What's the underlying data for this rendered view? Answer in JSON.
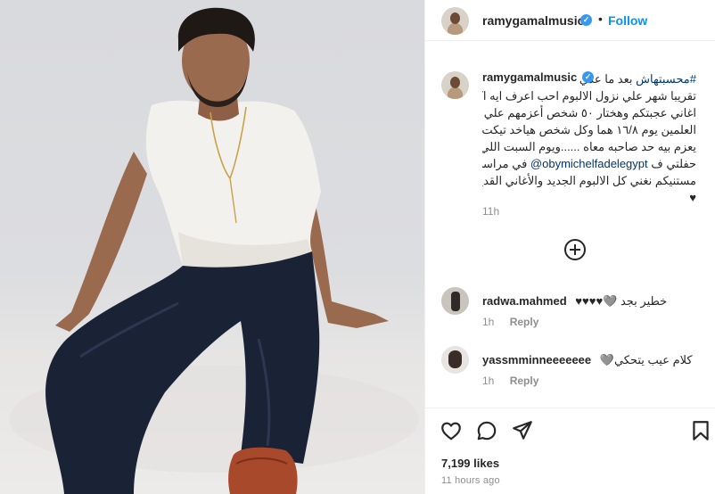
{
  "post": {
    "author": "ramygamalmusic",
    "dot": "•",
    "follow_label": "Follow",
    "verified_glyph": "✓"
  },
  "caption": {
    "username": "ramygamalmusic",
    "hashtag": "#محسبتهاش",
    "line1_rest": " بعد ما عدي",
    "line2": "تقريبا شهر علي نزول الالبوم احب اعرف ايه اكتر",
    "line3": "اغاني عجبتكم وهختار ٥٠ شخص أعزمهم علي حفله",
    "line4": "العلمين يوم ١٦/٨ هما وكل شخص هياخد تيكت زياده",
    "line5": "يعزم بيه حد صاحبه معاه ......ويوم السبت اللي جي ٨/٣",
    "line6_start": "حفلتي ف ",
    "mention": "@obymichelfadelegypt",
    "line6_end": " في مراسي",
    "line7": "مستنيكم نغني كل الالبوم الجديد والأغاني القديمه سوا ♥",
    "line8": "♥",
    "time": "11h"
  },
  "comments": [
    {
      "username": "radwa.mahmed",
      "text": "خطير بجد 🩶♥♥♥♥",
      "time": "1h",
      "reply_label": "Reply",
      "avatar_icon": "avatar-photo"
    },
    {
      "username": "yassmminneeeeeee",
      "text": "كلام عيب يتحكي🩶",
      "time": "1h",
      "reply_label": "Reply",
      "avatar_icon": "avatar-photo"
    }
  ],
  "actions": {
    "icons": [
      "heart-icon",
      "comment-icon",
      "share-icon",
      "bookmark-icon"
    ]
  },
  "likes": "7,199 likes",
  "posted": "11 hours ago",
  "colors": {
    "link_blue": "#0095f6",
    "verified_blue": "#3897f0",
    "muted": "#8e8e8e",
    "text": "#262626"
  }
}
